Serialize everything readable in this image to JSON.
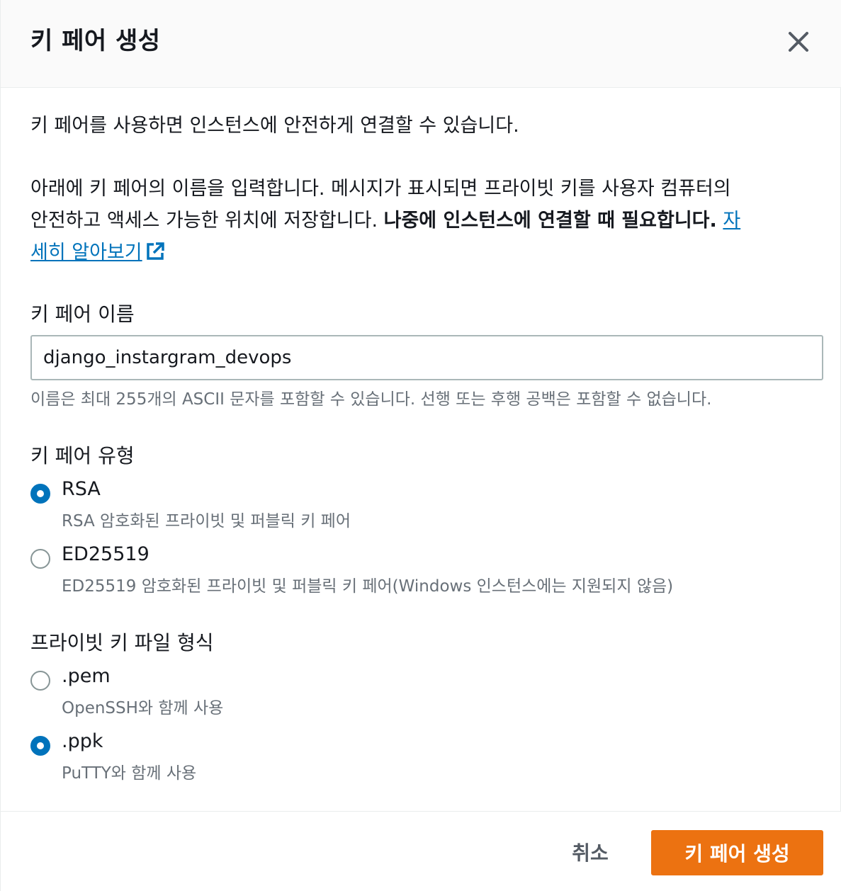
{
  "modal": {
    "title": "키 페어 생성",
    "close_icon": "close-icon"
  },
  "intro": "키 페어를 사용하면 인스턴스에 안전하게 연결할 수 있습니다.",
  "description": {
    "line1": "아래에 키 페어의 이름을 입력합니다. 메시지가 표시되면 프라이빗 키를 사용자 컴퓨터의",
    "line2": "안전하고 액세스 가능한 위치에 저장합니다. ",
    "bold": "나중에 인스턴스에 연결할 때 필요합니다.",
    "link_part1": "자",
    "link_part2": "세히 알아보기",
    "link_icon": "external-link-icon"
  },
  "key_name": {
    "label": "키 페어 이름",
    "value": "django_instargram_devops",
    "hint": "이름은 최대 255개의 ASCII 문자를 포함할 수 있습니다. 선행 또는 후행 공백은 포함할 수 없습니다."
  },
  "key_type": {
    "label": "키 페어 유형",
    "options": [
      {
        "label": "RSA",
        "description": "RSA 암호화된 프라이빗 및 퍼블릭 키 페어",
        "checked": true
      },
      {
        "label": "ED25519",
        "description": "ED25519 암호화된 프라이빗 및 퍼블릭 키 페어(Windows 인스턴스에는 지원되지 않음)",
        "checked": false
      }
    ]
  },
  "file_format": {
    "label": "프라이빗 키 파일 형식",
    "options": [
      {
        "label": ".pem",
        "description": "OpenSSH와 함께 사용",
        "checked": false
      },
      {
        "label": ".ppk",
        "description": "PuTTY와 함께 사용",
        "checked": true
      }
    ]
  },
  "footer": {
    "cancel_label": "취소",
    "create_label": "키 페어 생성"
  },
  "colors": {
    "primary_button": "#ec7211",
    "radio_selected": "#0073bb",
    "link": "#0073bb"
  }
}
